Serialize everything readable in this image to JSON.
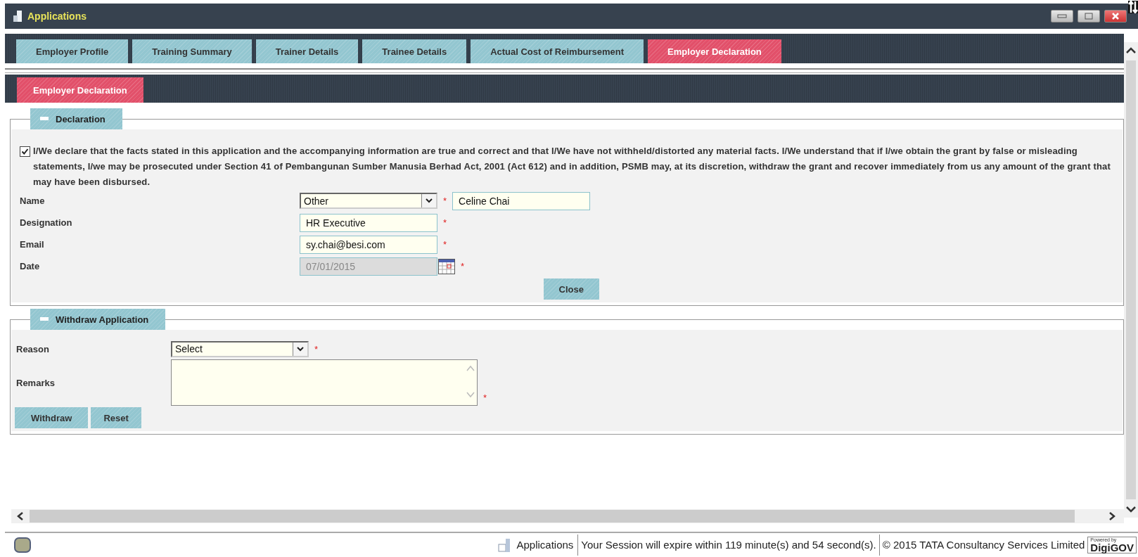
{
  "window": {
    "title": "Applications"
  },
  "tabs": [
    {
      "label": "Employer Profile",
      "selected": false
    },
    {
      "label": "Training Summary",
      "selected": false
    },
    {
      "label": "Trainer Details",
      "selected": false
    },
    {
      "label": "Trainee Details",
      "selected": false
    },
    {
      "label": "Actual Cost of Reimbursement",
      "selected": false
    },
    {
      "label": "Employer Declaration",
      "selected": true
    }
  ],
  "sub_tabs": [
    {
      "label": "Employer Declaration",
      "selected": true
    }
  ],
  "declaration": {
    "title": "Declaration",
    "expanded": true,
    "checked": true,
    "statement": "I/We declare that the facts stated in this application and the accompanying information are true and correct and that I/We have not withheld/distorted any material facts. I/We understand that if I/we obtain the grant by false or misleading statements, I/we may be prosecuted under Section 41 of Pembangunan Sumber Manusia Berhad Act, 2001 (Act 612) and in addition, PSMB may, at its discretion, withdraw the grant and recover immediately from us any amount of the grant that may have been disbursed.",
    "fields": [
      {
        "kind": "select-text",
        "label": "Name",
        "value": "Other",
        "extra_value": "Celine Chai",
        "required_mark": "*"
      },
      {
        "kind": "text",
        "label": "Designation",
        "value": "HR Executive",
        "required_mark": "*"
      },
      {
        "kind": "text",
        "label": "Email",
        "value": "sy.chai@besi.com",
        "required_mark": "*"
      },
      {
        "kind": "date",
        "label": "Date",
        "value": "07/01/2015",
        "required_mark": "*",
        "disabled": true
      }
    ],
    "button": "Close"
  },
  "withdraw": {
    "title": "Withdraw Application",
    "expanded": true,
    "fields": [
      {
        "kind": "select",
        "label": "Reason",
        "value": "Select",
        "required_mark": "*"
      },
      {
        "kind": "textarea",
        "label": "Remarks",
        "required_mark": "*"
      }
    ],
    "buttons": [
      "Withdraw",
      "Reset"
    ]
  },
  "status_bar": {
    "app": "Applications",
    "session": "Your Session will expire within 119 minute(s) and 54 second(s).",
    "copyright": "© 2015 TATA Consultancy Services Limited",
    "logo_caption": "Powered by",
    "logo": "DigiGOV"
  }
}
